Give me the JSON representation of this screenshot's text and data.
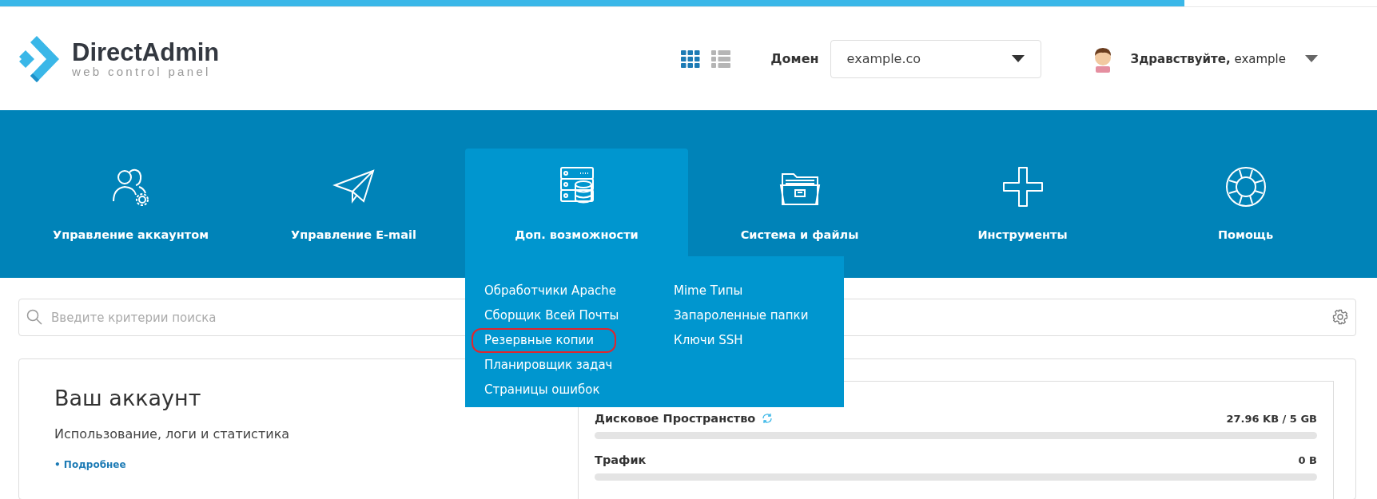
{
  "page_progress": {
    "level": 0.86
  },
  "logo": {
    "name": "DirectAdmin",
    "tagline": "web control panel"
  },
  "view_toggle": [
    {
      "kind": "grid",
      "selected": true
    },
    {
      "kind": "list",
      "selected": false
    }
  ],
  "domain": {
    "label": "Домен",
    "value": "example.co"
  },
  "user": {
    "greeting": "Здравствуйте,",
    "name": "example"
  },
  "nav": [
    {
      "kind": "account",
      "label": "Управление аккаунтом",
      "selected": false
    },
    {
      "kind": "email",
      "label": "Управление E-mail",
      "selected": false
    },
    {
      "kind": "extras",
      "label": "Доп. возможности",
      "selected": true,
      "menu": [
        [
          {
            "label": "Обработчики Apache",
            "highlighted": false
          },
          {
            "label": "Сборщик Всей Почты",
            "highlighted": false
          },
          {
            "label": "Резервные копии",
            "highlighted": true
          },
          {
            "label": "Планировщик задач",
            "highlighted": false
          },
          {
            "label": "Страницы ошибок",
            "highlighted": false
          }
        ],
        [
          {
            "label": "Mime Типы",
            "highlighted": false
          },
          {
            "label": "Запароленные папки",
            "highlighted": false
          },
          {
            "label": "Ключи SSH",
            "highlighted": false
          }
        ]
      ]
    },
    {
      "kind": "files",
      "label": "Система и файлы",
      "selected": false
    },
    {
      "kind": "tools",
      "label": "Инструменты",
      "selected": false
    },
    {
      "kind": "help",
      "label": "Помощь",
      "selected": false
    }
  ],
  "search": {
    "placeholder": "Введите критерии поиска"
  },
  "account_card": {
    "title": "Ваш аккаунт",
    "subtitle": "Использование, логи и статистика",
    "link": "• Подробнее",
    "usage": [
      {
        "label": "Дисковое Пространство",
        "refresh": true,
        "value": "27.96 KB / 5 GB",
        "level": 0
      },
      {
        "label": "Трафик",
        "refresh": false,
        "value": "0 B",
        "level": 0
      }
    ]
  }
}
